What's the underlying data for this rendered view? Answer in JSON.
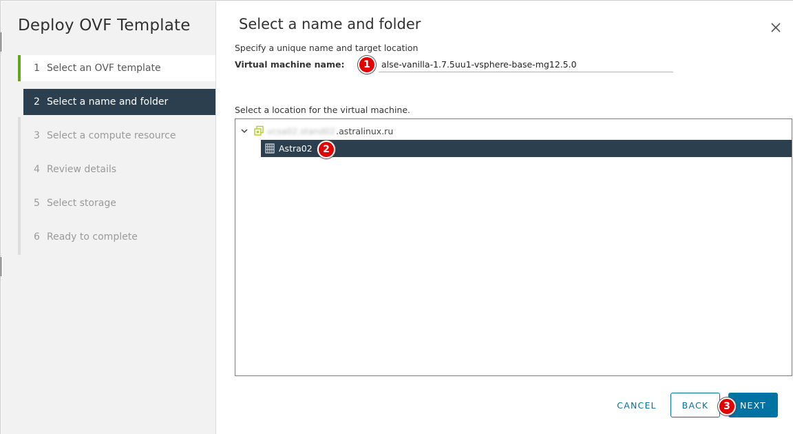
{
  "dialog": {
    "title": "Deploy OVF Template",
    "close_icon": "close-icon"
  },
  "steps": [
    {
      "num": "1",
      "label": "Select an OVF template",
      "state": "done"
    },
    {
      "num": "2",
      "label": "Select a name and folder",
      "state": "active"
    },
    {
      "num": "3",
      "label": "Select a compute resource",
      "state": "pending"
    },
    {
      "num": "4",
      "label": "Review details",
      "state": "pending"
    },
    {
      "num": "5",
      "label": "Select storage",
      "state": "pending"
    },
    {
      "num": "6",
      "label": "Ready to complete",
      "state": "pending"
    }
  ],
  "main": {
    "title": "Select a name and folder",
    "subtitle": "Specify a unique name and target location",
    "vm_name_label": "Virtual machine name:",
    "vm_name_value": "alse-vanilla-1.7.5uu1-vsphere-base-mg12.5.0",
    "location_label": "Select a location for the virtual machine."
  },
  "tree": {
    "root": {
      "icon": "vcenter-icon",
      "label_blurred": "vcsa02.stand02",
      "label_visible": ".astralinux.ru"
    },
    "child": {
      "icon": "datacenter-icon",
      "label": "Astra02"
    }
  },
  "footer": {
    "cancel_label": "CANCEL",
    "back_label": "BACK",
    "next_label": "NEXT"
  },
  "callouts": {
    "one": "1",
    "two": "2",
    "three": "3"
  },
  "colors": {
    "accent": "#0072a3",
    "active_step_bg": "#2b3f4f",
    "done_step_marker": "#62a420",
    "callout": "#e30000"
  }
}
